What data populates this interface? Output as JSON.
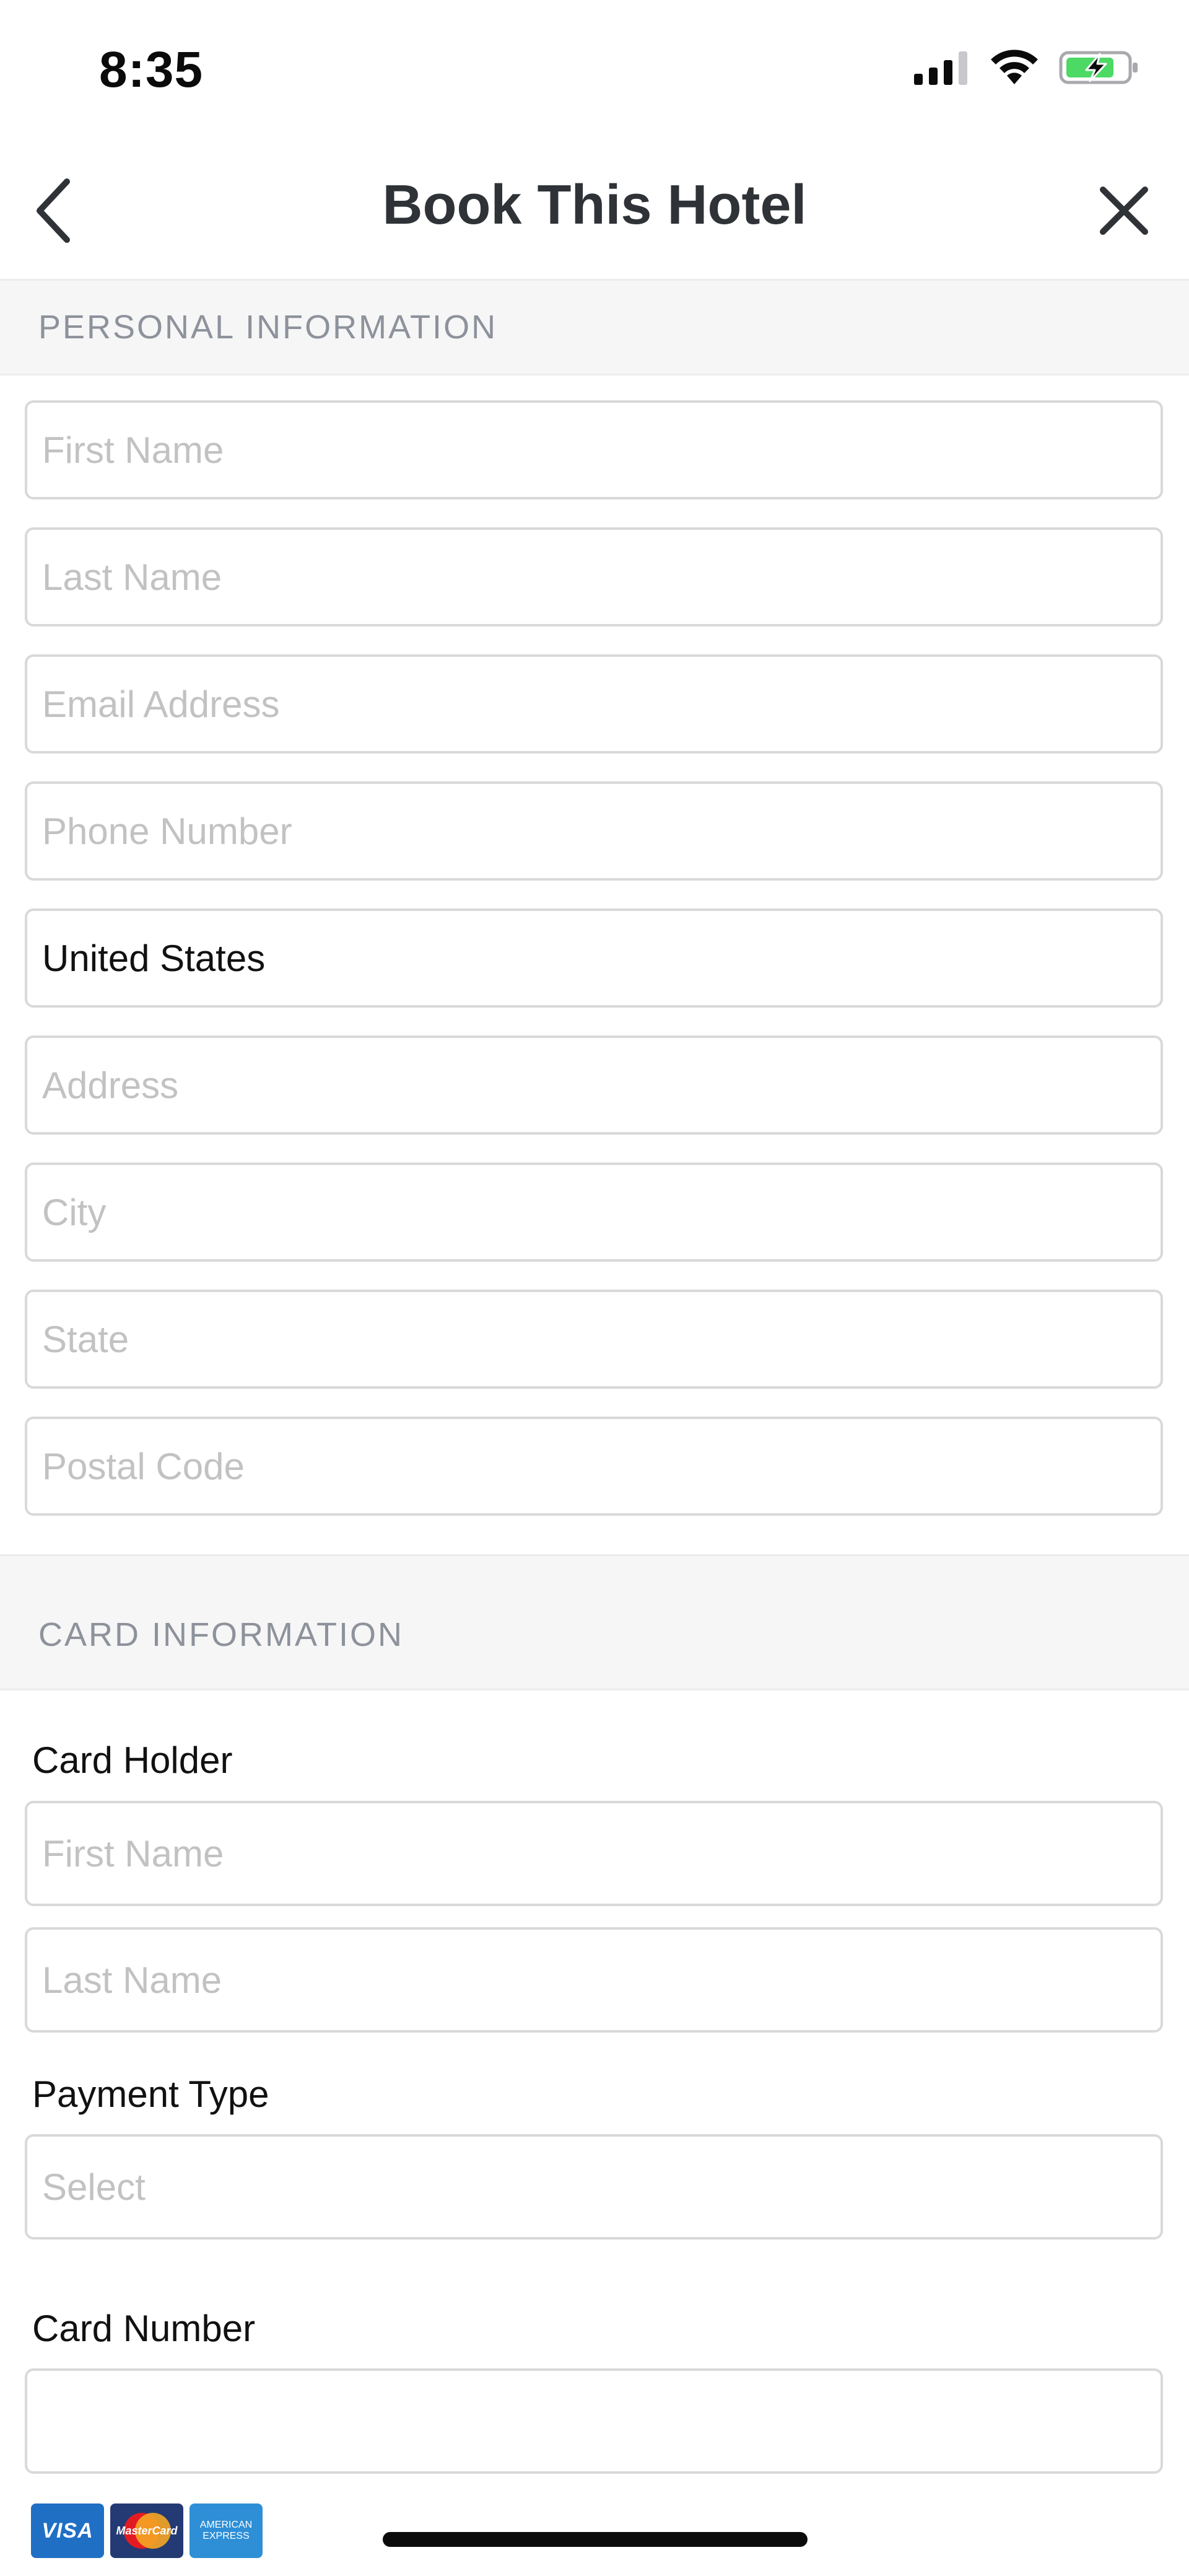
{
  "status_bar": {
    "time": "8:35"
  },
  "header": {
    "title": "Book This Hotel"
  },
  "sections": {
    "personal": "PERSONAL INFORMATION",
    "card": "CARD INFORMATION"
  },
  "personal_fields": {
    "first_name": {
      "placeholder": "First Name",
      "value": ""
    },
    "last_name": {
      "placeholder": "Last Name",
      "value": ""
    },
    "email": {
      "placeholder": "Email Address",
      "value": ""
    },
    "phone": {
      "placeholder": "Phone Number",
      "value": ""
    },
    "country": {
      "value": "United States"
    },
    "address": {
      "placeholder": "Address",
      "value": ""
    },
    "city": {
      "placeholder": "City",
      "value": ""
    },
    "state": {
      "placeholder": "State",
      "value": ""
    },
    "postal_code": {
      "placeholder": "Postal Code",
      "value": ""
    }
  },
  "card_fields": {
    "card_holder_label": "Card Holder",
    "holder_first_name": {
      "placeholder": "First Name",
      "value": ""
    },
    "holder_last_name": {
      "placeholder": "Last Name",
      "value": ""
    },
    "payment_type_label": "Payment Type",
    "payment_type": {
      "placeholder": "Select"
    },
    "card_number_label": "Card Number",
    "card_number": {
      "placeholder": "",
      "value": ""
    }
  },
  "card_logos": {
    "visa": "VISA",
    "mastercard": "MasterCard",
    "amex_line1": "AMERICAN",
    "amex_line2": "EXPRESS"
  },
  "colors": {
    "title": "#2f3236",
    "section_text": "#8d929b",
    "section_bg": "#f6f6f7",
    "field_border": "#d9d9d9",
    "placeholder": "#c2c2c2",
    "battery_green": "#4cd964"
  },
  "icons": {
    "back": "chevron-left-icon",
    "close": "close-icon",
    "signal": "signal-icon",
    "wifi": "wifi-icon",
    "battery": "battery-charging-icon"
  }
}
